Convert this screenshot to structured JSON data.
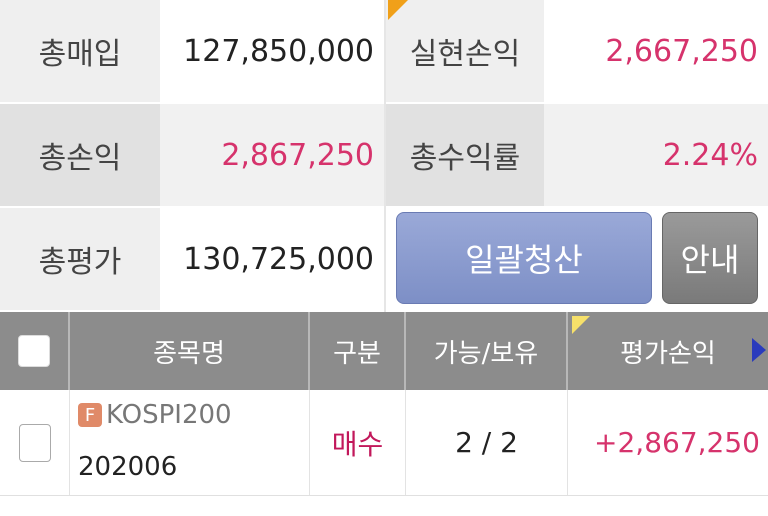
{
  "summary": {
    "total_buy_label": "총매입",
    "total_buy_value": "127,850,000",
    "realized_pnl_label": "실현손익",
    "realized_pnl_value": "2,667,250",
    "total_pnl_label": "총손익",
    "total_pnl_value": "2,867,250",
    "total_return_label": "총수익률",
    "total_return_value": "2.24%",
    "total_eval_label": "총평가",
    "total_eval_value": "130,725,000"
  },
  "buttons": {
    "bulk_close_label": "일괄청산",
    "guide_label": "안내"
  },
  "table": {
    "headers": [
      "종목명",
      "구분",
      "가능/보유",
      "평가손익"
    ],
    "rows": [
      {
        "badge": "F",
        "name": "KOSPI200",
        "code": "202006",
        "type": "매수",
        "avail_hold": "2 / 2",
        "eval_pnl": "+2,867,250"
      }
    ]
  },
  "colors": {
    "positive": "#d6336c",
    "buy": "#c2185b",
    "header_bg": "#8c8c8c",
    "bulk_button": "#8a9bd0",
    "guide_button": "#888888"
  }
}
